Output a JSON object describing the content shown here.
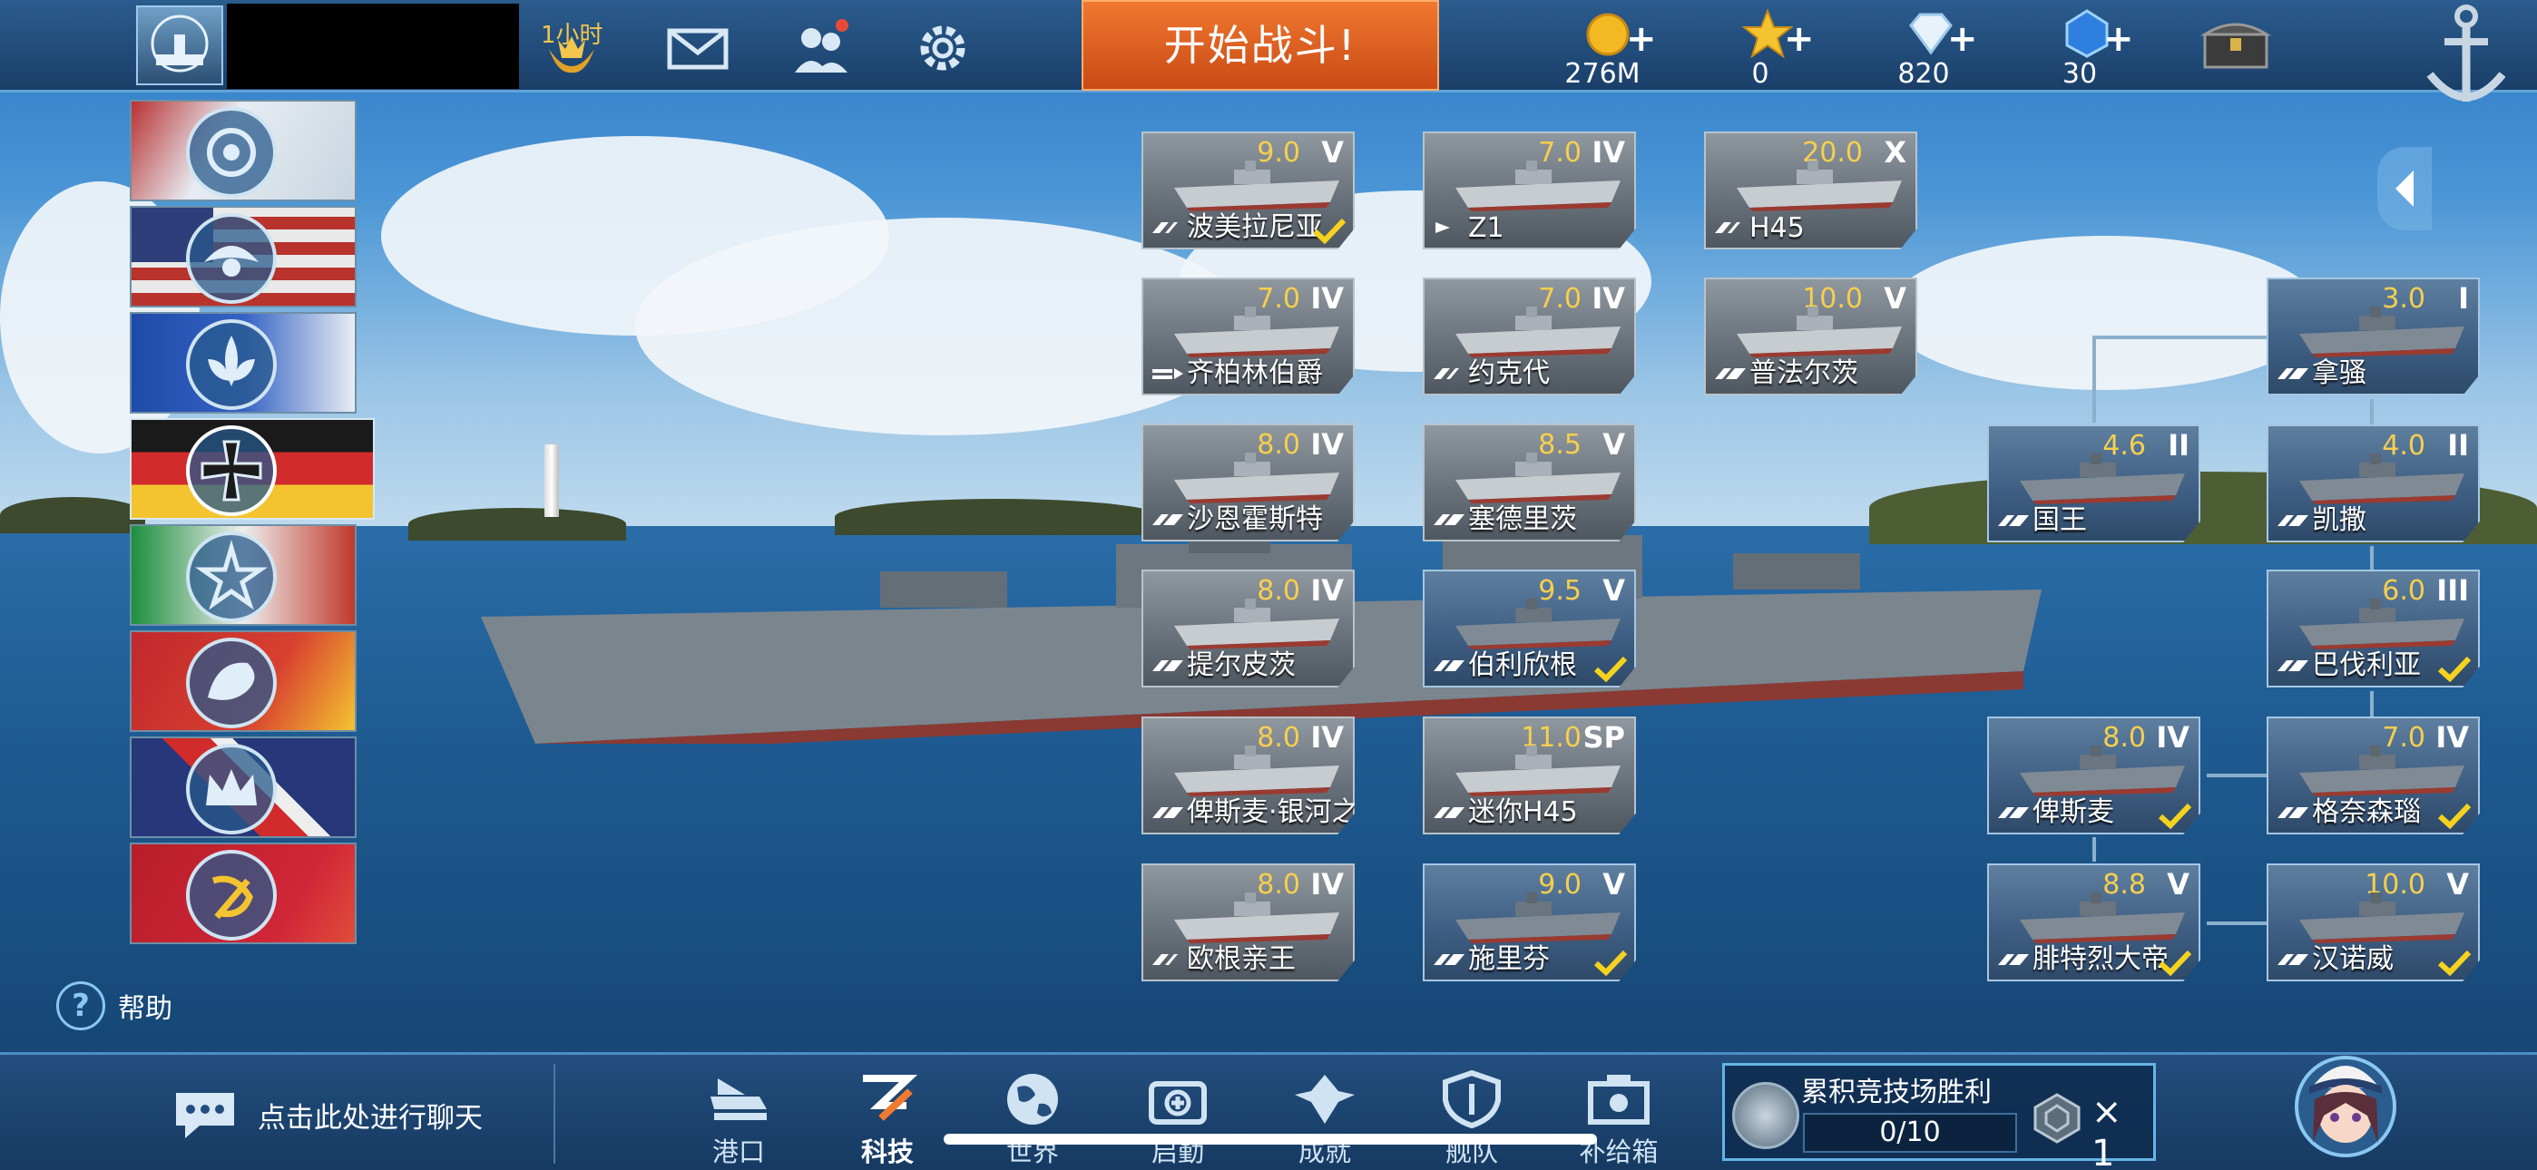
{
  "topbar": {
    "rank_label": "1小时",
    "battle_button": "开始战斗!",
    "resources": [
      {
        "icon": "gold-coin-icon",
        "value": "276M"
      },
      {
        "icon": "star-icon",
        "value": "0"
      },
      {
        "icon": "diamond-icon",
        "value": "820"
      },
      {
        "icon": "blue-crystal-icon",
        "value": "30"
      }
    ]
  },
  "nations": [
    {
      "name": "japan",
      "colors": [
        "#d9e4ee",
        "#c0392b"
      ]
    },
    {
      "name": "usa",
      "colors": [
        "#2d3e7a",
        "#b8332c"
      ]
    },
    {
      "name": "france",
      "colors": [
        "#1f4aa8",
        "#e8edf3"
      ]
    },
    {
      "name": "germany",
      "colors": [
        "#111",
        "#d12b2b",
        "#f4c430"
      ]
    },
    {
      "name": "italy",
      "colors": [
        "#1e8f3e",
        "#eee",
        "#c0392b"
      ]
    },
    {
      "name": "china",
      "colors": [
        "#c0282d",
        "#f4c430"
      ]
    },
    {
      "name": "uk",
      "colors": [
        "#26377a",
        "#d12b2b",
        "#eee"
      ]
    },
    {
      "name": "soviet",
      "colors": [
        "#b81e2a",
        "#f4c430"
      ]
    }
  ],
  "help_label": "帮助",
  "ships": [
    {
      "name": "波美拉尼亚",
      "level": "9.0",
      "tier": "V",
      "class": "cruiser",
      "owned": false,
      "checked": true
    },
    {
      "name": "Z1",
      "level": "7.0",
      "tier": "IV",
      "class": "destroyer",
      "owned": false,
      "checked": false
    },
    {
      "name": "H45",
      "level": "20.0",
      "tier": "X",
      "class": "cruiser",
      "owned": false,
      "checked": false
    },
    {
      "name": "齐柏林伯爵",
      "level": "7.0",
      "tier": "IV",
      "class": "carrier",
      "owned": false,
      "checked": false
    },
    {
      "name": "约克代",
      "level": "7.0",
      "tier": "IV",
      "class": "cruiser",
      "owned": false,
      "checked": false
    },
    {
      "name": "普法尔茨",
      "level": "10.0",
      "tier": "V",
      "class": "battleship",
      "owned": false,
      "checked": false
    },
    {
      "name": "沙恩霍斯特",
      "level": "8.0",
      "tier": "IV",
      "class": "battleship",
      "owned": false,
      "checked": false
    },
    {
      "name": "塞德里茨",
      "level": "8.5",
      "tier": "V",
      "class": "battleship",
      "owned": false,
      "checked": false
    },
    {
      "name": "提尔皮茨",
      "level": "8.0",
      "tier": "IV",
      "class": "battleship",
      "owned": false,
      "checked": false
    },
    {
      "name": "伯利欣根",
      "level": "9.5",
      "tier": "V",
      "class": "battleship",
      "owned": true,
      "checked": true
    },
    {
      "name": "俾斯麦·银河之征",
      "level": "8.0",
      "tier": "IV",
      "class": "battleship",
      "owned": false,
      "checked": false
    },
    {
      "name": "迷你H45",
      "level": "11.0",
      "tier": "SP",
      "class": "battleship",
      "owned": false,
      "checked": false
    },
    {
      "name": "欧根亲王",
      "level": "8.0",
      "tier": "IV",
      "class": "cruiser",
      "owned": false,
      "checked": false
    },
    {
      "name": "施里芬",
      "level": "9.0",
      "tier": "V",
      "class": "battleship",
      "owned": true,
      "checked": true
    },
    {
      "name": "拿骚",
      "level": "3.0",
      "tier": "I",
      "class": "battleship",
      "owned": true,
      "checked": false
    },
    {
      "name": "国王",
      "level": "4.6",
      "tier": "II",
      "class": "battleship",
      "owned": true,
      "checked": false
    },
    {
      "name": "凯撒",
      "level": "4.0",
      "tier": "II",
      "class": "battleship",
      "owned": true,
      "checked": false
    },
    {
      "name": "巴伐利亚",
      "level": "6.0",
      "tier": "III",
      "class": "battleship",
      "owned": true,
      "checked": true
    },
    {
      "name": "俾斯麦",
      "level": "8.0",
      "tier": "IV",
      "class": "battleship",
      "owned": true,
      "checked": true
    },
    {
      "name": "格奈森瑙",
      "level": "7.0",
      "tier": "IV",
      "class": "battleship",
      "owned": true,
      "checked": true
    },
    {
      "name": "腓特烈大帝",
      "level": "8.8",
      "tier": "V",
      "class": "battleship",
      "owned": true,
      "checked": true
    },
    {
      "name": "汉诺威",
      "level": "10.0",
      "tier": "V",
      "class": "battleship",
      "owned": true,
      "checked": true
    }
  ],
  "bottombar": {
    "chat_placeholder": "点击此处进行聊天",
    "nav": [
      {
        "label": "港口",
        "icon": "port-icon"
      },
      {
        "label": "科技",
        "icon": "tech-icon"
      },
      {
        "label": "世界",
        "icon": "globe-icon"
      },
      {
        "label": "启勤",
        "icon": "medic-icon"
      },
      {
        "label": "成就",
        "icon": "wings-icon"
      },
      {
        "label": "舰队",
        "icon": "fleet-shield-icon"
      },
      {
        "label": "补给箱",
        "icon": "supply-box-icon"
      }
    ],
    "arena": {
      "title": "累积竞技场胜利",
      "progress": "0/10",
      "reward_multiplier": "× 1",
      "progress_value": 0
    }
  },
  "colors": {
    "accent": "#f0782f",
    "gold": "#f6cf4d",
    "check": "#f4d21f"
  }
}
